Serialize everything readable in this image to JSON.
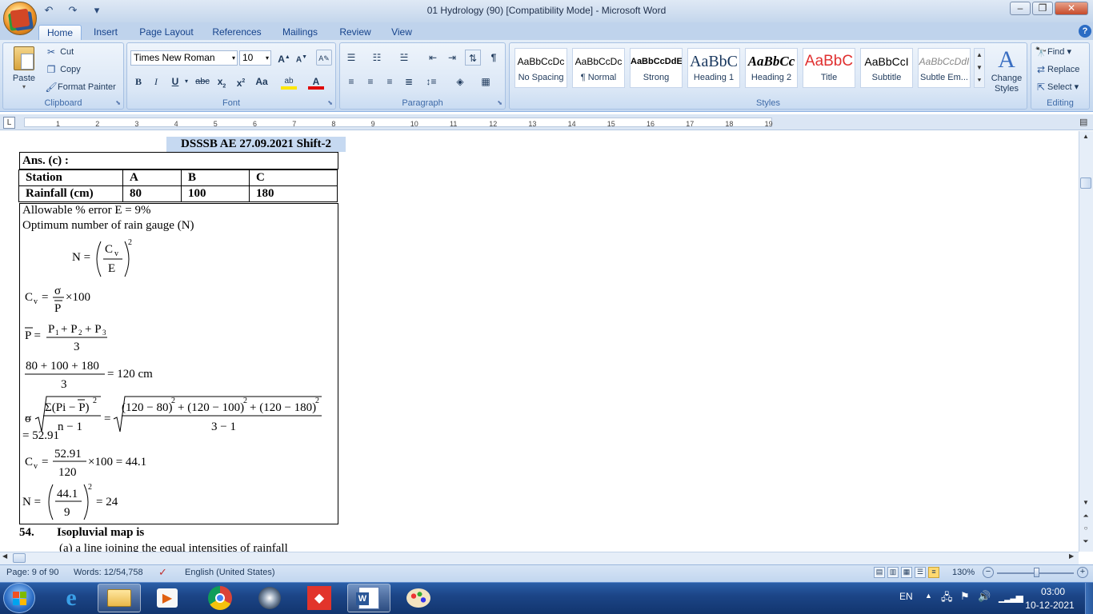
{
  "window": {
    "title": "01 Hydrology (90) [Compatibility Mode] - Microsoft Word",
    "minimize": "‒",
    "restore": "❐",
    "close": "✕"
  },
  "qat": {
    "undo": "↶",
    "redo": "↷",
    "customize": "▾"
  },
  "tabs": [
    "Home",
    "Insert",
    "Page Layout",
    "References",
    "Mailings",
    "Review",
    "View"
  ],
  "help_icon": "?",
  "ribbon": {
    "clipboard": {
      "label": "Clipboard",
      "paste": "Paste",
      "cut": "Cut",
      "copy": "Copy",
      "format_painter": "Format Painter"
    },
    "font": {
      "label": "Font",
      "family": "Times New Roman",
      "size": "10"
    },
    "paragraph": {
      "label": "Paragraph"
    },
    "styles": {
      "label": "Styles",
      "items": [
        {
          "sample": "AaBbCcDc",
          "name": "No Spacing"
        },
        {
          "sample": "AaBbCcDc",
          "name": "¶ Normal"
        },
        {
          "sample": "AaBbCcDdE",
          "name": "Strong"
        },
        {
          "sample": "AaBbC",
          "name": "Heading 1"
        },
        {
          "sample": "AaBbCc",
          "name": "Heading 2"
        },
        {
          "sample": "AaBbC",
          "name": "Title"
        },
        {
          "sample": "AaBbCcI",
          "name": "Subtitle"
        },
        {
          "sample": "AaBbCcDdI",
          "name": "Subtle Em..."
        }
      ],
      "change_styles": "Change Styles"
    },
    "editing": {
      "label": "Editing",
      "find": "Find",
      "replace": "Replace",
      "select": "Select"
    }
  },
  "ruler": {
    "numbers": [
      "1",
      "2",
      "3",
      "4",
      "5",
      "6",
      "7",
      "8",
      "9",
      "10",
      "11",
      "12",
      "13",
      "14",
      "15",
      "16",
      "17",
      "18",
      "19"
    ]
  },
  "document": {
    "exam_tag": "DSSSB AE 27.09.2021 Shift-2",
    "answer": "Ans. (c) :",
    "table": {
      "headers": [
        "Station",
        "A",
        "B",
        "C"
      ],
      "rows": [
        [
          "Rainfall (cm)",
          "80",
          "100",
          "180"
        ]
      ]
    },
    "allowable_error": "Allowable % error E = 9%",
    "optimum_rain_gauge": "Optimum number of rain gauge (N)",
    "sigma_result": "= 52.91",
    "question_number": "54.",
    "question_text": "Isopluvial map is",
    "option_a": "(a)  a line joining the equal intensities of rainfall"
  },
  "statusbar": {
    "page": "Page: 9 of 90",
    "words": "Words: 12/54,758",
    "language": "English (United States)",
    "zoom": "130%"
  },
  "taskbar": {
    "lang": "EN",
    "time": "03:00",
    "date": "10-12-2021"
  }
}
